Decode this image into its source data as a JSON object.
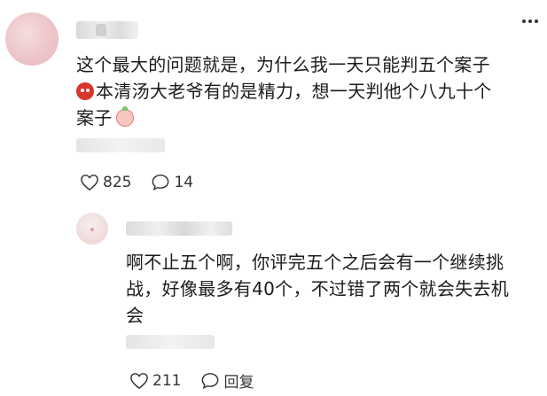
{
  "main_comment": {
    "avatar": "avatar-blurred",
    "text_line1": "这个最大的问题就是，为什么我一天只能判五个案子",
    "text_line2": "本清汤大老爷有的是精力，想一天判他个八九十个",
    "text_line3": "案子",
    "emoji_1": "angry-face-emoji",
    "emoji_2": "peach-emoji",
    "likes": "825",
    "replies": "14"
  },
  "reply": {
    "avatar": "avatar-blurred",
    "text_line1": "啊不止五个啊，你评完五个之后会有一个继续挑",
    "text_line2": "战，好像最多有40个，不过错了两个就会失去机",
    "text_line3": "会",
    "likes": "211",
    "reply_label": "回复"
  },
  "icons": {
    "like": "heart-icon",
    "comment": "comment-bubble-icon",
    "more": "more-dots-icon"
  },
  "colors": {
    "text": "#1b1b1b",
    "icon": "#333333",
    "background": "#ffffff"
  }
}
